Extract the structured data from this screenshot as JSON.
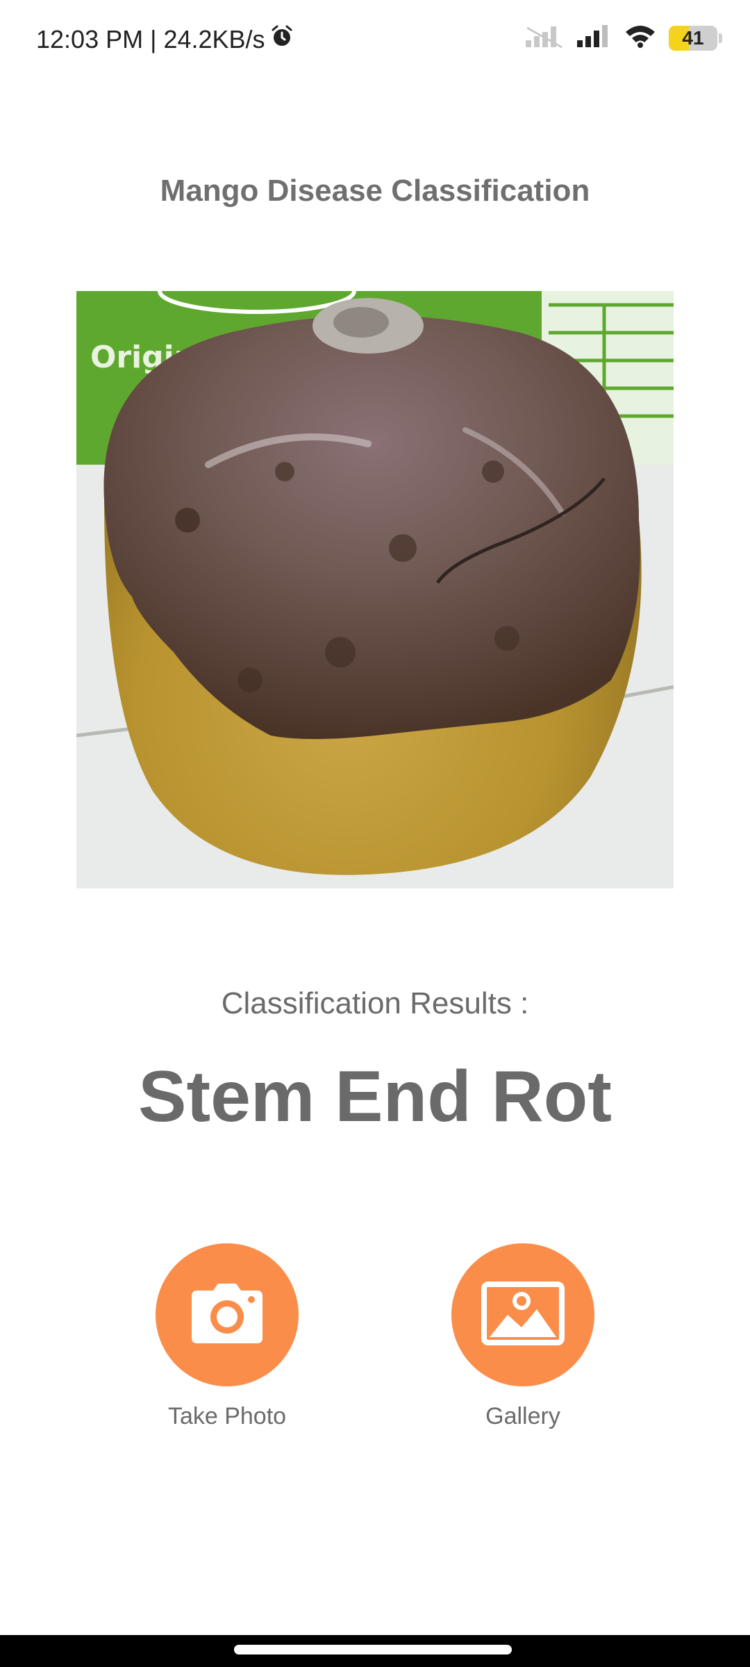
{
  "status_bar": {
    "time_speed": "12:03 PM | 24.2KB/s",
    "battery_level": "41",
    "icons": [
      "alarm-icon",
      "signal-icon",
      "signal-icon",
      "wifi-icon",
      "battery-icon"
    ]
  },
  "app": {
    "title": "Mango Disease Classification"
  },
  "image": {
    "description_icon": "mango-photo"
  },
  "results": {
    "label": "Classification Results :",
    "value": "Stem End Rot"
  },
  "actions": {
    "take_photo_label": "Take Photo",
    "gallery_label": "Gallery"
  },
  "colors": {
    "accent": "#fb8d4a",
    "text": "#6a6a6a",
    "battery": "#f5d21c"
  }
}
